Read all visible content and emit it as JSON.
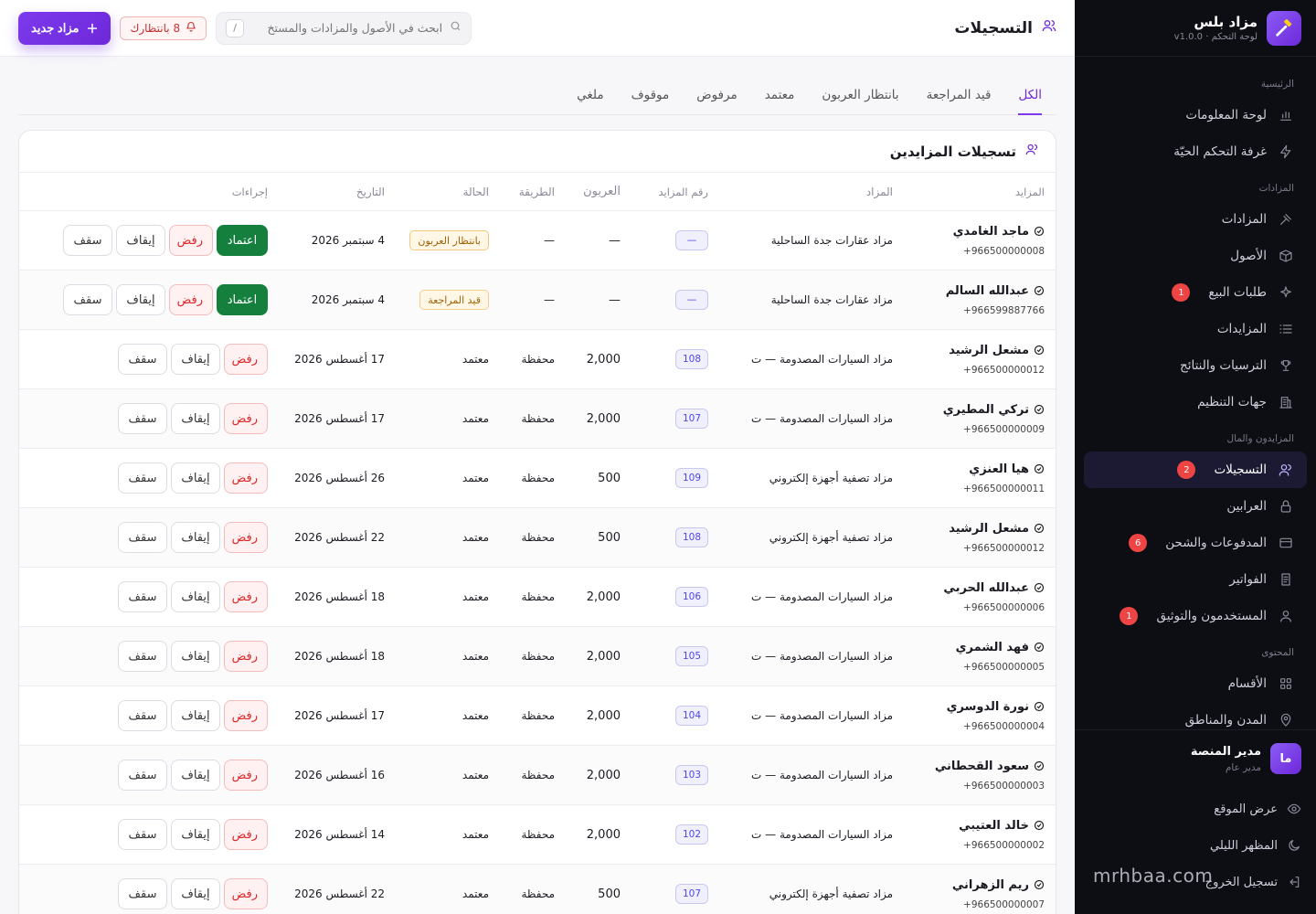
{
  "brand": {
    "title": "مزاد بلس",
    "subtitle": "لوحة التحكم · v1.0.0"
  },
  "header": {
    "title": "التسجيلات",
    "search_placeholder": "ابحث في الأصول والمزادات والمستخ",
    "kbd": "/",
    "pending_label": "8 بانتظارك",
    "new_button": "مزاد جديد"
  },
  "sidebar": {
    "groups": [
      {
        "label": "الرئيسية",
        "items": [
          {
            "label": "لوحة المعلومات",
            "icon": "chart-icon"
          },
          {
            "label": "غرفة التحكم الحيّة",
            "icon": "bolt-icon"
          }
        ]
      },
      {
        "label": "المزادات",
        "items": [
          {
            "label": "المزادات",
            "icon": "gavel-icon"
          },
          {
            "label": "الأصول",
            "icon": "box-icon"
          },
          {
            "label": "طلبات البيع",
            "icon": "sparkle-icon",
            "badge": "1"
          },
          {
            "label": "المزايدات",
            "icon": "list-icon"
          },
          {
            "label": "الترسيات والنتائج",
            "icon": "trophy-icon"
          },
          {
            "label": "جهات التنظيم",
            "icon": "building-icon"
          }
        ]
      },
      {
        "label": "المزايدون والمال",
        "items": [
          {
            "label": "التسجيلات",
            "icon": "users-icon",
            "badge": "2",
            "active": true
          },
          {
            "label": "العرابين",
            "icon": "lock-icon"
          },
          {
            "label": "المدفوعات والشحن",
            "icon": "card-icon",
            "badge": "6"
          },
          {
            "label": "الفواتير",
            "icon": "invoice-icon"
          },
          {
            "label": "المستخدمون والتوثيق",
            "icon": "user-icon",
            "badge": "1"
          }
        ]
      },
      {
        "label": "المحتوى",
        "items": [
          {
            "label": "الأقسام",
            "icon": "grid-icon"
          },
          {
            "label": "المدن والمناطق",
            "icon": "pin-icon"
          }
        ]
      }
    ],
    "admin": {
      "initials": "ما",
      "name": "مدير المنصة",
      "role": "مدير عام"
    },
    "footer": [
      {
        "label": "عرض الموقع",
        "icon": "eye-icon"
      },
      {
        "label": "المظهر الليلي",
        "icon": "moon-icon"
      },
      {
        "label": "تسجيل الخروج",
        "icon": "logout-icon"
      }
    ],
    "watermark": "mrhbaa.com"
  },
  "tabs": [
    "الكل",
    "قيد المراجعة",
    "بانتظار العربون",
    "معتمد",
    "مرفوض",
    "موقوف",
    "ملغي"
  ],
  "table": {
    "title": "تسجيلات المزايدين",
    "columns": [
      "المزايد",
      "المزاد",
      "رقم المزايد",
      "العربون",
      "الطريقة",
      "الحالة",
      "التاريخ",
      "إجراءات"
    ],
    "actions": {
      "approve": "اعتماد",
      "reject": "رفض",
      "stop": "إيقاف",
      "cap": "سقف"
    },
    "rows": [
      {
        "name": "ماجد الغامدي",
        "phone": "+966500000008",
        "auction": "مزاد عقارات جدة الساحلية",
        "no": "—",
        "deposit": "—",
        "method": "—",
        "status": "بانتظار العربون",
        "status_type": "wait",
        "date": "4 سبتمبر 2026"
      },
      {
        "name": "عبدالله السالم",
        "phone": "+966599887766",
        "auction": "مزاد عقارات جدة الساحلية",
        "no": "—",
        "deposit": "—",
        "method": "—",
        "status": "قيد المراجعة",
        "status_type": "review",
        "date": "4 سبتمبر 2026"
      },
      {
        "name": "مشعل الرشيد",
        "phone": "+966500000012",
        "auction": "مزاد السيارات المصدومة — ت",
        "no": "108",
        "deposit": "2,000",
        "method": "محفظة",
        "status": "معتمد",
        "status_type": "approved",
        "date": "17 أغسطس 2026"
      },
      {
        "name": "تركي المطيري",
        "phone": "+966500000009",
        "auction": "مزاد السيارات المصدومة — ت",
        "no": "107",
        "deposit": "2,000",
        "method": "محفظة",
        "status": "معتمد",
        "status_type": "approved",
        "date": "17 أغسطس 2026"
      },
      {
        "name": "هيا العنزي",
        "phone": "+966500000011",
        "auction": "مزاد تصفية أجهزة إلكتروني",
        "no": "109",
        "deposit": "500",
        "method": "محفظة",
        "status": "معتمد",
        "status_type": "approved",
        "date": "26 أغسطس 2026"
      },
      {
        "name": "مشعل الرشيد",
        "phone": "+966500000012",
        "auction": "مزاد تصفية أجهزة إلكتروني",
        "no": "108",
        "deposit": "500",
        "method": "محفظة",
        "status": "معتمد",
        "status_type": "approved",
        "date": "22 أغسطس 2026"
      },
      {
        "name": "عبدالله الحربي",
        "phone": "+966500000006",
        "auction": "مزاد السيارات المصدومة — ت",
        "no": "106",
        "deposit": "2,000",
        "method": "محفظة",
        "status": "معتمد",
        "status_type": "approved",
        "date": "18 أغسطس 2026"
      },
      {
        "name": "فهد الشمري",
        "phone": "+966500000005",
        "auction": "مزاد السيارات المصدومة — ت",
        "no": "105",
        "deposit": "2,000",
        "method": "محفظة",
        "status": "معتمد",
        "status_type": "approved",
        "date": "18 أغسطس 2026"
      },
      {
        "name": "نورة الدوسري",
        "phone": "+966500000004",
        "auction": "مزاد السيارات المصدومة — ت",
        "no": "104",
        "deposit": "2,000",
        "method": "محفظة",
        "status": "معتمد",
        "status_type": "approved",
        "date": "17 أغسطس 2026"
      },
      {
        "name": "سعود القحطاني",
        "phone": "+966500000003",
        "auction": "مزاد السيارات المصدومة — ت",
        "no": "103",
        "deposit": "2,000",
        "method": "محفظة",
        "status": "معتمد",
        "status_type": "approved",
        "date": "16 أغسطس 2026"
      },
      {
        "name": "خالد العتيبي",
        "phone": "+966500000002",
        "auction": "مزاد السيارات المصدومة — ت",
        "no": "102",
        "deposit": "2,000",
        "method": "محفظة",
        "status": "معتمد",
        "status_type": "approved",
        "date": "14 أغسطس 2026"
      },
      {
        "name": "ريم الزهراني",
        "phone": "+966500000007",
        "auction": "مزاد تصفية أجهزة إلكتروني",
        "no": "107",
        "deposit": "500",
        "method": "محفظة",
        "status": "معتمد",
        "status_type": "approved",
        "date": "22 أغسطس 2026"
      }
    ]
  },
  "colors": {
    "accent": "#7c3aed",
    "approve": "#15803d",
    "reject": "#dc2626",
    "sidebar_bg": "#0d0d14"
  }
}
